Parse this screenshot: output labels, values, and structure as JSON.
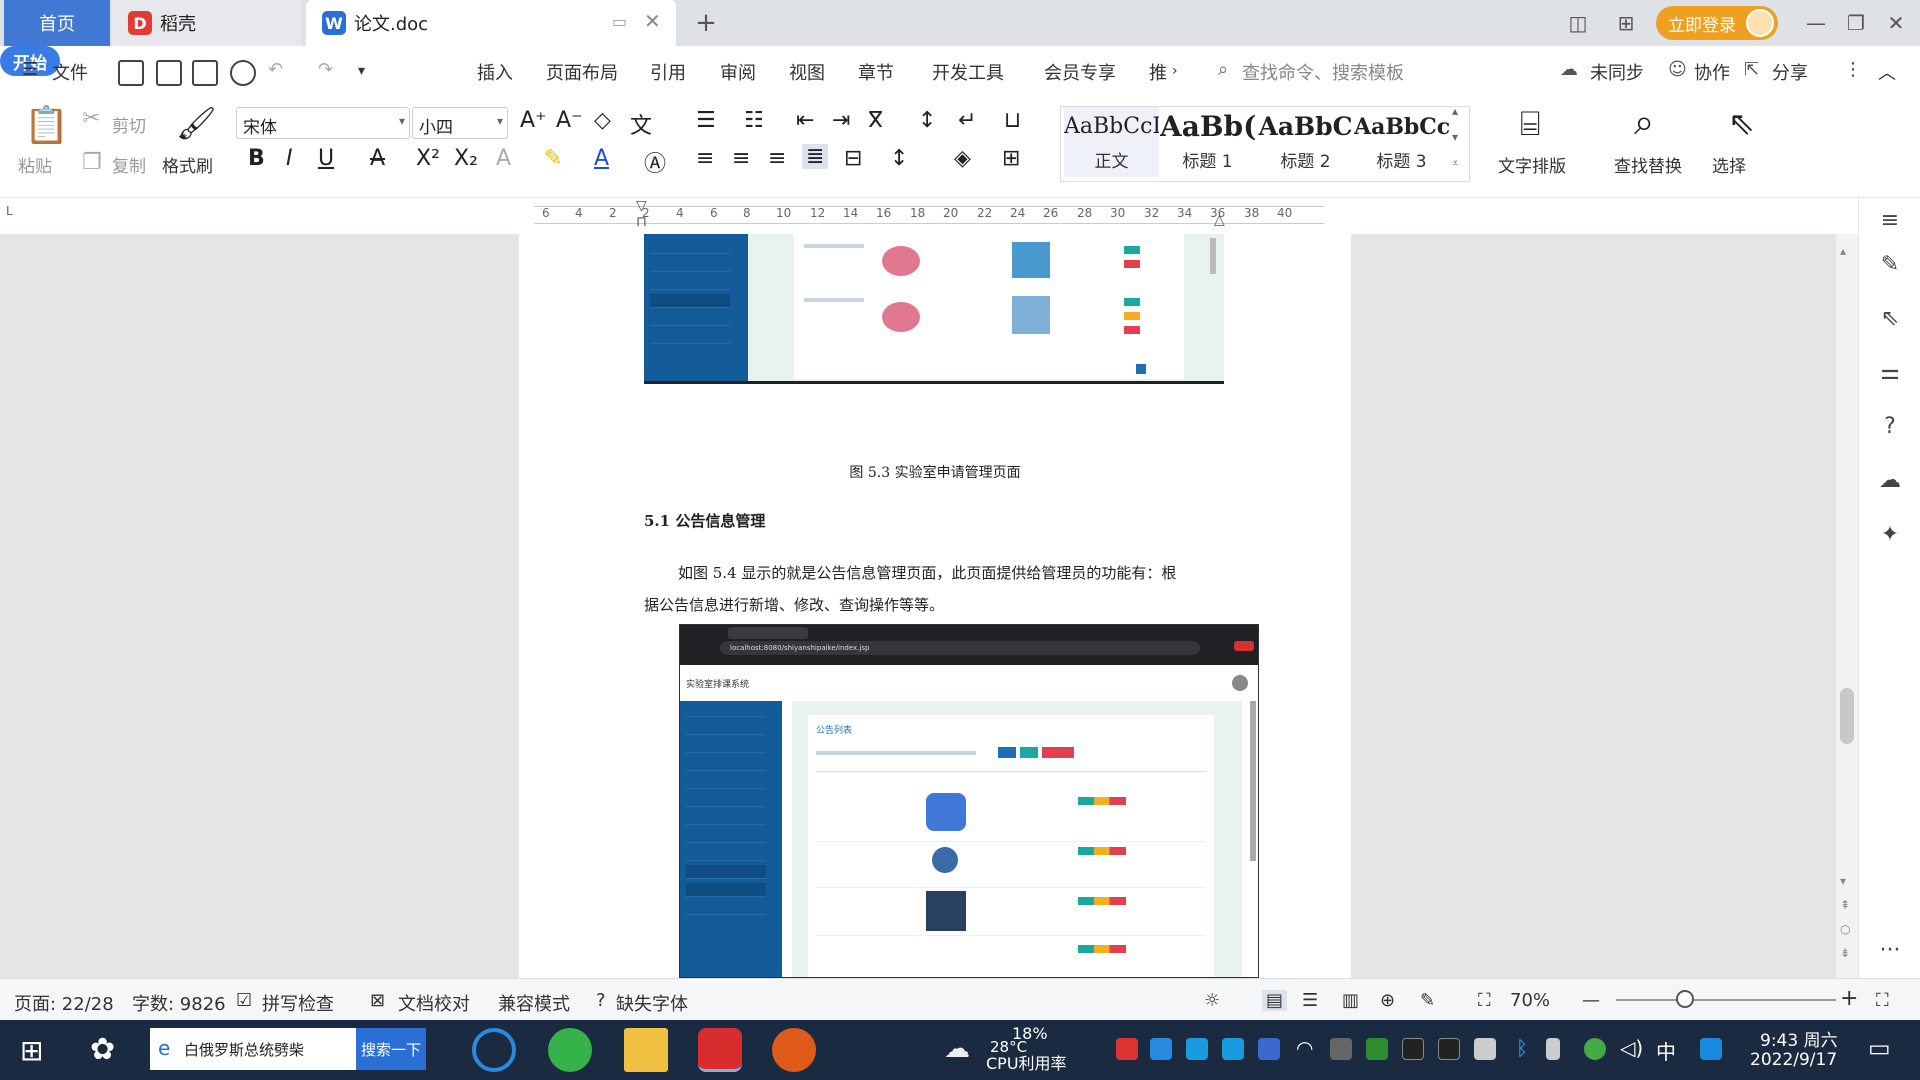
{
  "tabs": {
    "home": "首页",
    "daoke": "稻壳",
    "doc": "论文.doc"
  },
  "login": "立即登录",
  "menu": {
    "file": "文件",
    "start": "开始",
    "insert": "插入",
    "layout": "页面布局",
    "ref": "引用",
    "review": "审阅",
    "view": "视图",
    "chapter": "章节",
    "devtools": "开发工具",
    "vip": "会员专享",
    "more": "推",
    "search_placeholder": "查找命令、搜索模板",
    "sync": "未同步",
    "collab": "协作",
    "share": "分享"
  },
  "ribbon": {
    "paste": "粘贴",
    "cut": "剪切",
    "copy": "复制",
    "format_painter": "格式刷",
    "font": "宋体",
    "size": "小四",
    "text_layout": "文字排版",
    "find_replace": "查找替换",
    "select": "选择"
  },
  "styles": [
    {
      "preview": "AaBbCcI",
      "name": "正文"
    },
    {
      "preview": "AaBb(",
      "name": "标题 1"
    },
    {
      "preview": "AaBbC",
      "name": "标题 2"
    },
    {
      "preview": "AaBbCcl",
      "name": "标题 3"
    }
  ],
  "ruler_labels": [
    "6",
    "4",
    "2",
    "2",
    "4",
    "6",
    "8",
    "10",
    "12",
    "14",
    "16",
    "18",
    "20",
    "22",
    "24",
    "26",
    "28",
    "30",
    "32",
    "34",
    "36",
    "38",
    "40"
  ],
  "doc": {
    "caption": "图 5.3 实验室申请管理页面",
    "heading": "5.1 公告信息管理",
    "para1": "如图 5.4 显示的就是公告信息管理页面，此页面提供给管理员的功能有：根",
    "para2": "据公告信息进行新增、修改、查询操作等等。",
    "shot2": {
      "system": "实验室排课系统",
      "panel": "公告列表",
      "url": "localhost:8080/shiyanshipaike/index.jsp"
    }
  },
  "status": {
    "page": "页面: 22/28",
    "words": "字数: 9826",
    "spell": "拼写检查",
    "proof": "文档校对",
    "compat": "兼容模式",
    "missing_font": "缺失字体",
    "zoom": "70%"
  },
  "taskbar": {
    "search_text": "白俄罗斯总统劈柴",
    "search_btn": "搜索一下",
    "weather": "28°C",
    "cpu_pct": "18%",
    "cpu_label": "CPU利用率",
    "ime": "中",
    "time": "9:43 周六",
    "date": "2022/9/17"
  }
}
